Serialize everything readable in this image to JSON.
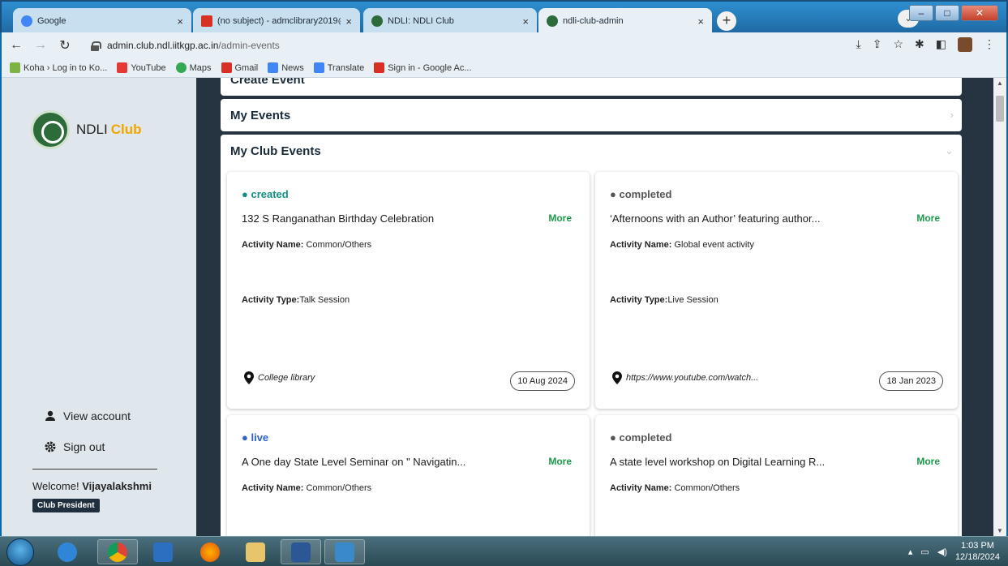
{
  "browser": {
    "tabs": [
      {
        "title": "Google",
        "color": "#4285f4",
        "active": false
      },
      {
        "title": "(no subject) - admclibrary2019@",
        "color": "#d93025",
        "active": false
      },
      {
        "title": "NDLI: NDLI Club",
        "color": "#2e6b3a",
        "active": false
      },
      {
        "title": "ndli-club-admin",
        "color": "#2e6b3a",
        "active": true
      }
    ],
    "new_tab_label": "+",
    "url_host": "admin.club.ndl.iitkgp.ac.in",
    "url_path": "/admin-events",
    "bookmarks": [
      {
        "label": "Koha › Log in to Ko...",
        "color": "#7cb342"
      },
      {
        "label": "YouTube",
        "color": "#e53935"
      },
      {
        "label": "Maps",
        "color": "#34a853"
      },
      {
        "label": "Gmail",
        "color": "#d93025"
      },
      {
        "label": "News",
        "color": "#4285f4"
      },
      {
        "label": "Translate",
        "color": "#4285f4"
      },
      {
        "label": "Sign in - Google Ac...",
        "color": "#d93025"
      }
    ]
  },
  "sidebar": {
    "brand_main": "NDLI",
    "brand_club": "Club",
    "view_account": "View account",
    "sign_out": "Sign out",
    "welcome_prefix": "Welcome!",
    "user_name": "Vijayalakshmi",
    "role": "Club President"
  },
  "main": {
    "create_event_label": "Create Event",
    "my_events_label": "My Events",
    "my_club_events_label": "My Club Events",
    "activity_name_label": "Activity Name:",
    "activity_type_label": "Activity Type:",
    "more_label": "More",
    "events": [
      {
        "status": "created",
        "status_color": "#138f82",
        "title": "132 S Ranganathan Birthday Celebration",
        "activity_name": "Common/Others",
        "activity_type": "Talk Session",
        "location": "College library",
        "date": "10 Aug 2024"
      },
      {
        "status": "completed",
        "status_color": "#555555",
        "title": "‘Afternoons with an Author’ featuring author...",
        "activity_name": "Global event activity",
        "activity_type": "Live Session",
        "location": "https://www.youtube.com/watch...",
        "date": "18 Jan 2023"
      },
      {
        "status": "live",
        "status_color": "#2a64c8",
        "title": "A One day State Level Seminar on \" Navigatin...",
        "activity_name": "Common/Others"
      },
      {
        "status": "completed",
        "status_color": "#555555",
        "title": "A state level workshop on Digital Learning R...",
        "activity_name": "Common/Others"
      }
    ]
  },
  "taskbar": {
    "time": "1:03 PM",
    "date": "12/18/2024"
  }
}
